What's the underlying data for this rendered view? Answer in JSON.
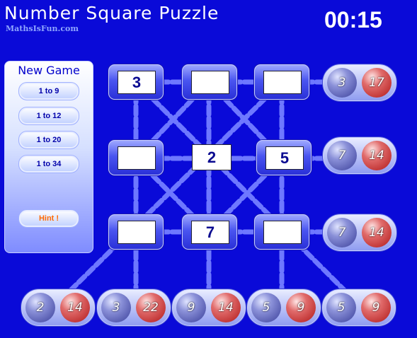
{
  "header": {
    "title": "Number Square Puzzle",
    "brand": "MathsIsFun.com",
    "timer": "00:15"
  },
  "panel": {
    "title": "New Game",
    "buttons": [
      "1 to 9",
      "1 to 12",
      "1 to 20",
      "1 to 34"
    ],
    "hint": "Hint !"
  },
  "grid": {
    "rows": [
      [
        "3",
        "",
        ""
      ],
      [
        "",
        "2",
        "5"
      ],
      [
        "",
        "7",
        ""
      ]
    ]
  },
  "row_targets": [
    {
      "blue": "3",
      "red": "17"
    },
    {
      "blue": "7",
      "red": "14"
    },
    {
      "blue": "7",
      "red": "14"
    }
  ],
  "bottom_targets": [
    {
      "blue": "2",
      "red": "14"
    },
    {
      "blue": "3",
      "red": "22"
    },
    {
      "blue": "9",
      "red": "14"
    },
    {
      "blue": "5",
      "red": "9"
    },
    {
      "blue": "5",
      "red": "9"
    }
  ],
  "colors": {
    "background": "#0a0ad8",
    "line": "#6e78ff",
    "blue_ball": "#6a70c0",
    "red_ball": "#d03838"
  }
}
